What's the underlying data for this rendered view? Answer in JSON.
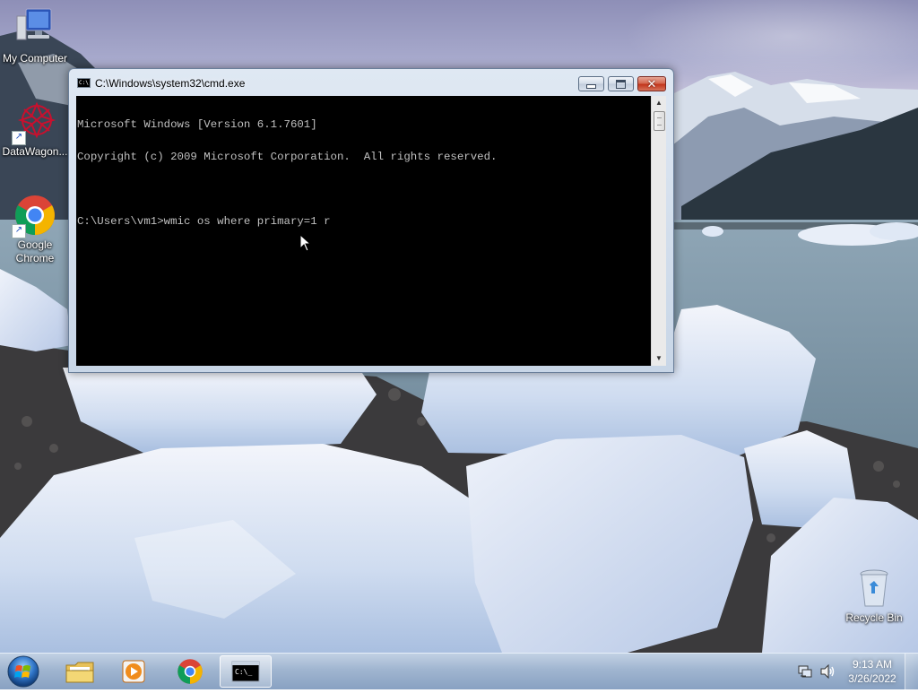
{
  "desktop": {
    "icons": [
      {
        "label": "My Computer",
        "icon": "computer-icon"
      },
      {
        "label": "DataWagon...",
        "icon": "datawagon-icon"
      },
      {
        "label": "Google Chrome",
        "icon": "chrome-icon"
      },
      {
        "label": "Recycle Bin",
        "icon": "recycle-bin-icon"
      }
    ]
  },
  "window": {
    "title": "C:\\Windows\\system32\\cmd.exe",
    "icon": "cmd-icon",
    "controls": {
      "minimize": "minimize-icon",
      "maximize": "maximize-icon",
      "close": "close-icon"
    },
    "console_lines": [
      "Microsoft Windows [Version 6.1.7601]",
      "Copyright (c) 2009 Microsoft Corporation.  All rights reserved.",
      "",
      "C:\\Users\\vm1>wmic os where primary=1 r"
    ]
  },
  "taskbar": {
    "start": "windows-start-orb",
    "pinned": [
      {
        "icon": "file-explorer-icon"
      },
      {
        "icon": "media-player-icon"
      },
      {
        "icon": "chrome-icon"
      },
      {
        "icon": "cmd-icon",
        "active": true
      }
    ],
    "tray": {
      "network": "network-icon",
      "volume": "volume-icon",
      "time": "9:13 AM",
      "date": "3/26/2022"
    }
  },
  "colors": {
    "console_bg": "#000000",
    "console_fg": "#c0c0c0",
    "close_button": "#c7412a",
    "taskbar": "#9cb2ce"
  }
}
